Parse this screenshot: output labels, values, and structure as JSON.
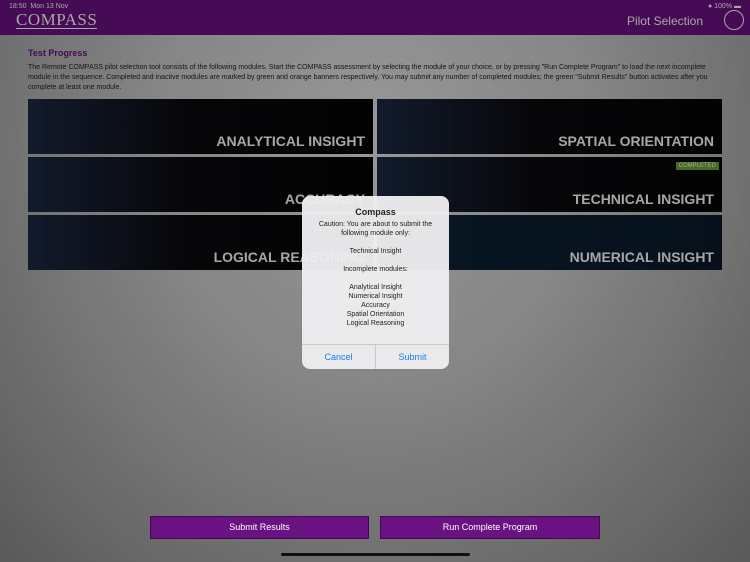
{
  "status": {
    "time": "18:50",
    "date": "Mon 13 Nov",
    "battery": "100%"
  },
  "header": {
    "logo": "COMPASS",
    "title": "Pilot Selection"
  },
  "heading": "Test Progress",
  "description": "The Remote COMPASS pilot selection tool consists of the following modules. Start the COMPASS assessment by selecting the module of your choice, or by pressing \"Run Complete Program\" to load the next incomplete module in the sequence. Completed and inactive modules are marked by green and orange banners respectively. You may submit any number of completed modules; the green \"Submit Results\" button activates after you complete at least one module.",
  "modules": [
    {
      "label": "ANALYTICAL INSIGHT"
    },
    {
      "label": "SPATIAL ORIENTATION"
    },
    {
      "label": "ACCURACY"
    },
    {
      "label": "TECHNICAL INSIGHT",
      "badge": "COMPLETED"
    },
    {
      "label": "LOGICAL REASONING"
    },
    {
      "label": "NUMERICAL INSIGHT"
    }
  ],
  "dialog": {
    "title": "Compass",
    "message": "Caution: You are about to submit the following module only:",
    "submitted": "Technical Insight",
    "incomplete_label": "Incomplete modules:",
    "incomplete": [
      "Analytical Insight",
      "Numerical Insight",
      "Accuracy",
      "Spatial Orientation",
      "Logical Reasoning"
    ],
    "cancel": "Cancel",
    "submit": "Submit"
  },
  "buttons": {
    "submit_results": "Submit Results",
    "run_complete": "Run Complete Program"
  }
}
